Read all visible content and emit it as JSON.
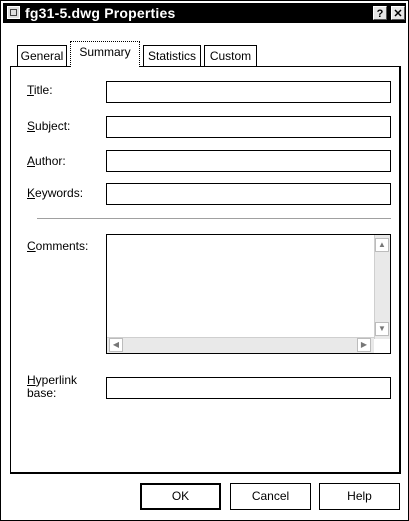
{
  "window": {
    "title": "fg31-5.dwg Properties",
    "help_glyph": "?",
    "close_glyph": "✕"
  },
  "tabs": [
    {
      "label": "General",
      "active": false
    },
    {
      "label": "Summary",
      "active": true
    },
    {
      "label": "Statistics",
      "active": false
    },
    {
      "label": "Custom",
      "active": false
    }
  ],
  "fields": {
    "title": {
      "label_mn": "T",
      "label_rest": "itle:",
      "value": ""
    },
    "subject": {
      "label_mn": "S",
      "label_rest": "ubject:",
      "value": ""
    },
    "author": {
      "label_mn": "A",
      "label_rest": "uthor:",
      "value": ""
    },
    "keywords": {
      "label_mn": "K",
      "label_rest": "eywords:",
      "value": ""
    },
    "comments": {
      "label_mn": "C",
      "label_rest": "omments:",
      "value": ""
    },
    "hyperlink": {
      "label_mn": "H",
      "label_line1_rest": "yperlink",
      "label_line2": "base:",
      "value": ""
    }
  },
  "scroll_glyphs": {
    "up": "▲",
    "down": "▼",
    "left": "◀",
    "right": "▶"
  },
  "buttons": {
    "ok": "OK",
    "cancel": "Cancel",
    "help": "Help"
  }
}
